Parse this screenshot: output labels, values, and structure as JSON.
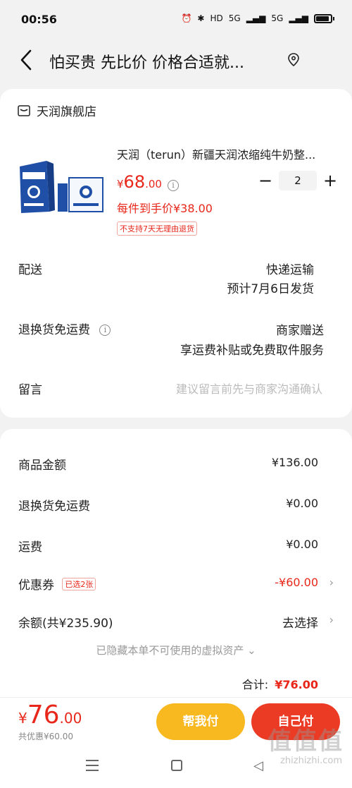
{
  "status": {
    "time": "00:56",
    "hd": "HD",
    "net1": "5G",
    "net2": "5G"
  },
  "header": {
    "title": "怕买贵 先比价 价格合适就..."
  },
  "shop": {
    "name": "天润旗舰店"
  },
  "product": {
    "title": "天润（terun）新疆天润浓缩纯牛奶整...",
    "price_currency": "¥",
    "price_int": "68",
    "price_dec": ".00",
    "unit_price": "每件到手价¥38.00",
    "return_badge": "不支持7天无理由退货",
    "quantity": "2",
    "qty_minus": "−",
    "qty_plus": "+"
  },
  "delivery": {
    "label": "配送",
    "method": "快递运输",
    "eta": "预计7月6日发货"
  },
  "return_shipping": {
    "label": "退换货免运费",
    "value": "商家赠送",
    "detail": "享运费补贴或免费取件服务"
  },
  "message": {
    "label": "留言",
    "placeholder": "建议留言前先与商家沟通确认"
  },
  "summary": {
    "goods_label": "商品金额",
    "goods_value": "¥136.00",
    "return_fee_label": "退换货免运费",
    "return_fee_value": "¥0.00",
    "shipping_label": "运费",
    "shipping_value": "¥0.00",
    "coupon_label": "优惠券",
    "coupon_badge": "已选2张",
    "coupon_value": "-¥60.00",
    "balance_label": "余额(共¥235.90)",
    "balance_action": "去选择",
    "hidden_assets": "已隐藏本单不可使用的虚拟资产",
    "total_label": "合计:",
    "total_value": "¥76.00"
  },
  "footer": {
    "pay_currency": "¥",
    "pay_int": "76",
    "pay_dec": ".00",
    "discount": "共优惠¥60.00",
    "helper_button": "帮我付",
    "self_button": "自己付"
  },
  "watermark": {
    "main": "值值值",
    "sub": "zhizhizhi.com"
  },
  "colors": {
    "accent": "#e8261a",
    "helper": "#f8b820",
    "self": "#ec3b24"
  }
}
